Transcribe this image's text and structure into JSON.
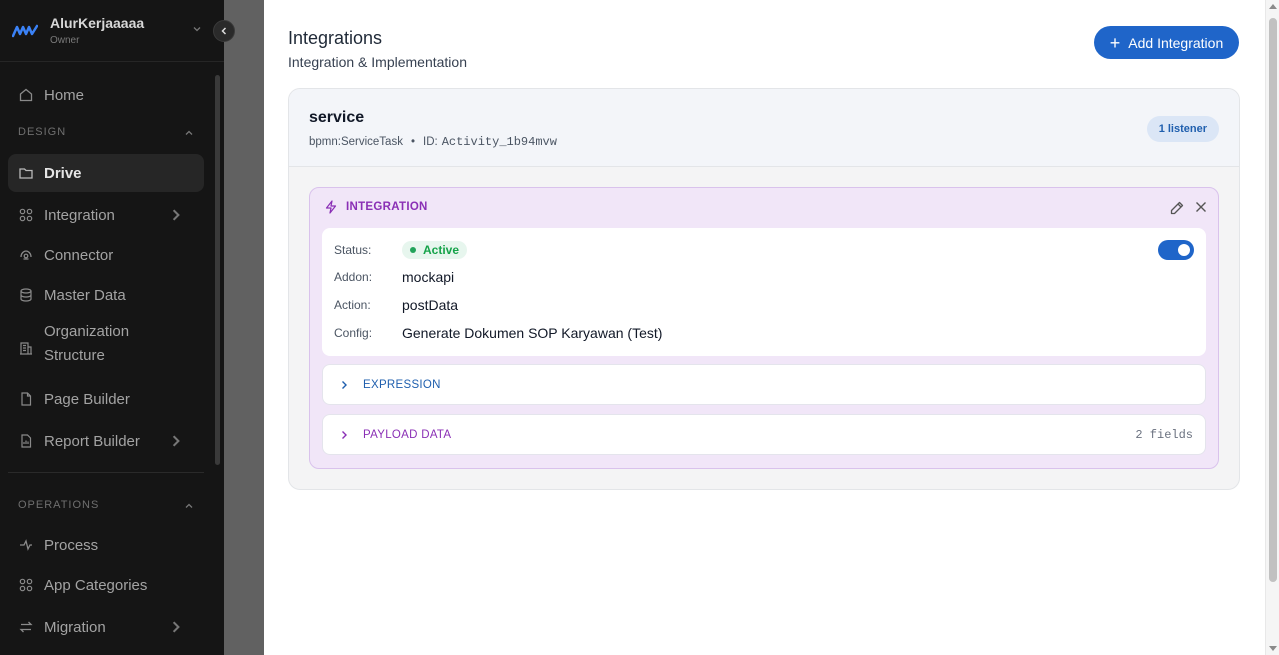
{
  "sidebar": {
    "workspace_name": "AlurKerjaaaaa",
    "workspace_role": "Owner",
    "sections": {
      "design": "DESIGN",
      "operations": "OPERATIONS"
    },
    "items": {
      "home": "Home",
      "drive": "Drive",
      "integration": "Integration",
      "connector": "Connector",
      "master_data": "Master Data",
      "org_structure_1": "Organization",
      "org_structure_2": "Structure",
      "page_builder": "Page Builder",
      "report_builder": "Report Builder",
      "process": "Process",
      "app_categories": "App Categories",
      "migration": "Migration"
    }
  },
  "panel": {
    "title": "Integrations",
    "subtitle": "Integration & Implementation",
    "add_button": "Add Integration",
    "plus": "+"
  },
  "service": {
    "name": "service",
    "type": "bpmn:ServiceTask",
    "separator": "•",
    "id_label": "ID:",
    "id_value": "Activity_1b94mvw",
    "listener_badge": "1 listener"
  },
  "integration": {
    "header": "INTEGRATION",
    "status_label": "Status:",
    "status_value": "Active",
    "addon_label": "Addon:",
    "addon_value": "mockapi",
    "action_label": "Action:",
    "action_value": "postData",
    "config_label": "Config:",
    "config_value": "Generate Dokumen SOP Karyawan (Test)",
    "enabled": true,
    "expression_label": "EXPRESSION",
    "payload_label": "PAYLOAD DATA",
    "payload_count": "2 fields"
  },
  "colors": {
    "accent": "#1f65c9",
    "purple": "#8a2fb5",
    "expression": "#1f5fae",
    "active": "#16a34a"
  }
}
